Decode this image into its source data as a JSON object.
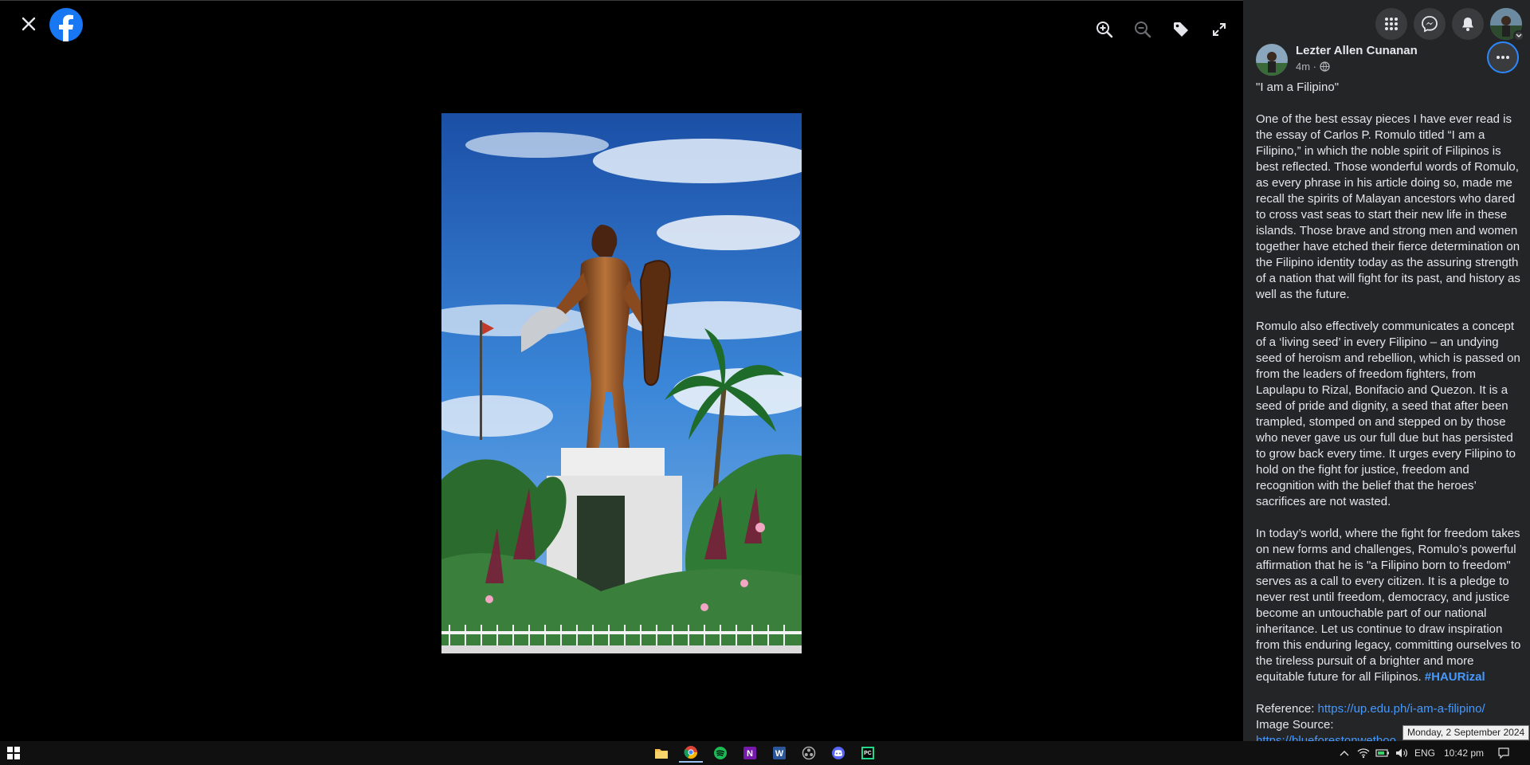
{
  "viewer": {
    "toolbar": {
      "close_icon": "close-icon",
      "logo_icon": "facebook-logo-icon",
      "zoom_in_icon": "zoom-in-icon",
      "zoom_out_icon": "zoom-out-icon",
      "tag_icon": "tag-icon",
      "fullscreen_icon": "fullscreen-icon"
    }
  },
  "header_icons": [
    "menu-grid-icon",
    "messenger-icon",
    "notifications-icon",
    "profile-avatar"
  ],
  "post": {
    "author": "Lezter Allen Cunanan",
    "time": "4m",
    "title": "\"I am a Filipino\"",
    "paragraph1": "One of the best essay pieces I have ever read is the essay of Carlos P. Romulo titled “I am a Filipino,” in which the noble spirit of Filipinos is best reflected. Those wonderful words of Romulo, as every phrase in his article doing so, made me recall the spirits of Malayan ancestors who dared to cross vast seas to start their new life in these islands. Those brave and strong men and women together have etched their fierce determination on the Filipino identity today as the assuring strength of a nation that will fight for its past, and history as well as the future.",
    "paragraph2": "Romulo also effectively communicates a concept of a ‘living seed’ in every Filipino – an undying seed of heroism and rebellion, which is passed on from the leaders of freedom fighters, from Lapulapu to Rizal, Bonifacio and Quezon. It is a seed of pride and dignity, a seed that after been trampled, stomped on and stepped on by those who never gave us our full due but has persisted to grow back every time. It urges every Filipino to hold on the fight for justice, freedom and recognition with the belief that the heroes’ sacrifices are not wasted.",
    "paragraph3": "In today’s world, where the fight for freedom takes on new forms and challenges, Romulo’s powerful affirmation that he is \"a Filipino born to freedom\" serves as a call to every citizen. It is a pledge to never rest until freedom, democracy, and justice become an untouchable part of our national inheritance. Let us continue to draw inspiration from this enduring legacy, committing ourselves to the tireless pursuit of a brighter and more equitable future for all Filipinos.",
    "hashtag": "#HAURizal",
    "reference_label": "Reference:",
    "reference_link": "https://up.edu.ph/i-am-a-filipino/",
    "image_source_label": "Image Source:",
    "image_source_link": "https://blueforestonwetboo..."
  },
  "tooltip": "Monday, 2 September 2024",
  "taskbar": {
    "apps": [
      "file-explorer-icon",
      "chrome-icon",
      "spotify-icon",
      "onenote-icon",
      "word-icon",
      "obs-icon",
      "discord-icon",
      "pycharm-icon"
    ],
    "language": "ENG",
    "clock": "10:42 pm"
  },
  "colors": {
    "panel_bg": "#242526",
    "link": "#4599ff",
    "fb_blue": "#1877f2",
    "accent_ring": "#2d88ff"
  }
}
